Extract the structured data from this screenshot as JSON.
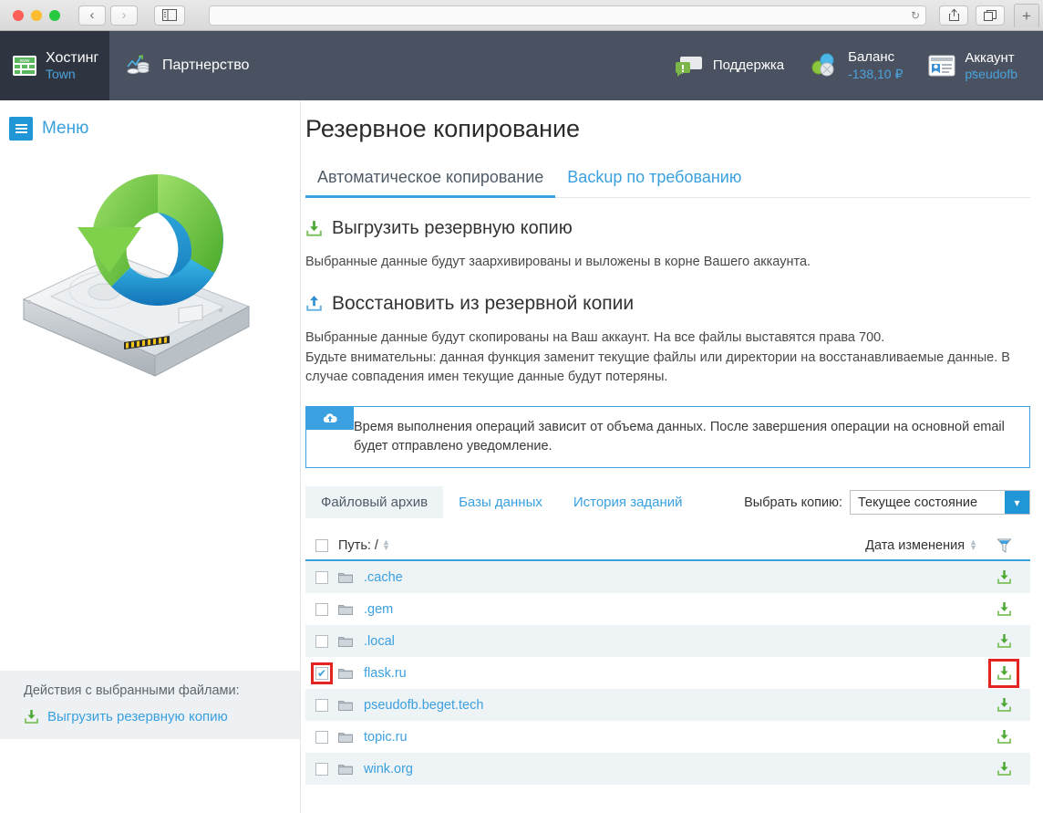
{
  "browser": {
    "back_label": "‹",
    "forward_label": "›",
    "sidebar_icon": "sidebar-icon",
    "reload_label": "↻",
    "share_label": "share-icon",
    "tabs_label": "tabs-icon",
    "newtab_label": "+",
    "url_value": ""
  },
  "appbar": {
    "brand": {
      "title": "Хостинг",
      "sub": "Town"
    },
    "nav": [
      {
        "label": "Партнерство"
      }
    ],
    "support": {
      "label": "Поддержка"
    },
    "balance": {
      "label": "Баланс",
      "value": "-138,10 ₽"
    },
    "account": {
      "label": "Аккаунт",
      "value": "pseudofb",
      "caret": "⌄"
    }
  },
  "sidebar": {
    "menu_label": "Меню",
    "actions_title": "Действия с выбранными файлами:",
    "action_link": "Выгрузить резервную копию"
  },
  "main": {
    "page_title": "Резервное копирование",
    "tabs": [
      {
        "label": "Автоматическое копирование",
        "active": true
      },
      {
        "label": "Backup по требованию",
        "active": false
      }
    ],
    "export_section": {
      "title": "Выгрузить резервную копию",
      "text": "Выбранные данные будут заархивированы и выложены в корне Вашего аккаунта."
    },
    "restore_section": {
      "title": "Восстановить из резервной копии",
      "text": "Выбранные данные будут скопированы на Ваш аккаунт. На все файлы выставятся права 700.\nБудьте внимательны: данная функция заменит текущие файлы или директории на восстанавливаемые данные. В случае совпадения имен текущие данные будут потеряны."
    },
    "notice": "Время выполнения операций зависит от объема данных. После завершения операции на основной email будет отправлено уведомление.",
    "subtabs": [
      {
        "label": "Файловый архив",
        "active": true
      },
      {
        "label": "Базы данных",
        "active": false
      },
      {
        "label": "История заданий",
        "active": false
      }
    ],
    "copy_select": {
      "label": "Выбрать копию:",
      "value": "Текущее состояние",
      "options": [
        "Текущее состояние"
      ]
    },
    "table": {
      "col_path": "Путь: /",
      "col_date": "Дата изменения",
      "rows": [
        {
          "name": ".cache",
          "checked": false,
          "date": ""
        },
        {
          "name": ".gem",
          "checked": false,
          "date": ""
        },
        {
          "name": ".local",
          "checked": false,
          "date": ""
        },
        {
          "name": "flask.ru",
          "checked": true,
          "date": ""
        },
        {
          "name": "pseudofb.beget.tech",
          "checked": false,
          "date": ""
        },
        {
          "name": "topic.ru",
          "checked": false,
          "date": ""
        },
        {
          "name": "wink.org",
          "checked": false,
          "date": ""
        }
      ]
    }
  },
  "colors": {
    "accent": "#3aa0e0",
    "topbar": "#4a5160",
    "brand_dark": "#2f3540",
    "green": "#5cb85c",
    "highlight_red": "#e52421",
    "row_alt": "#eef3f6"
  }
}
